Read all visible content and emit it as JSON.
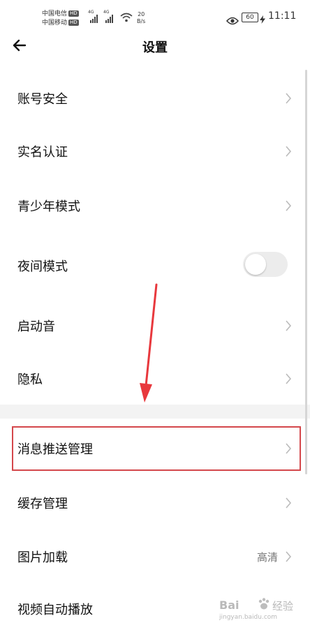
{
  "status_bar": {
    "carrier1": "中国电信",
    "carrier2": "中国移动",
    "hd1": "HD",
    "hd2": "HD",
    "net1": "4G",
    "net2": "4G",
    "net_speed_value": "20",
    "net_speed_unit": "B/s",
    "battery": "60",
    "time": "11:11"
  },
  "header": {
    "title": "设置"
  },
  "settings": {
    "account_security": "账号安全",
    "real_name": "实名认证",
    "youth_mode": "青少年模式",
    "night_mode": "夜间模式",
    "night_mode_on": false,
    "startup_sound": "启动音",
    "privacy": "隐私",
    "push_management": "消息推送管理",
    "cache_management": "缓存管理",
    "image_loading": "图片加载",
    "image_loading_value": "高清",
    "video_autoplay": "视频自动播放"
  },
  "watermark": {
    "logo": "Bai",
    "logo_suffix": "经验",
    "url": "jingyan.baidu.com"
  },
  "colors": {
    "highlight": "#d4474b",
    "arrow": "#e8383d"
  }
}
